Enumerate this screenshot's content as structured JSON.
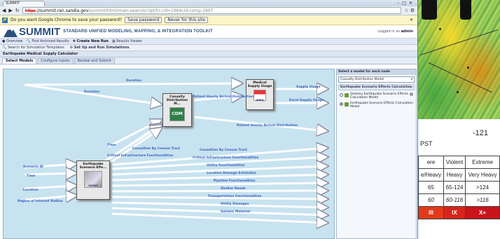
{
  "background": {
    "tick_label": "-121",
    "pst_label": "PST",
    "severity_table": {
      "rows": [
        [
          "ere",
          "Violent",
          "Extreme"
        ],
        [
          "e/Heavy",
          "Heavy",
          "Very Heavy"
        ],
        [
          "65",
          "65-124",
          ">124"
        ],
        [
          "60",
          "60-116",
          ">116"
        ],
        [
          "III",
          "IX",
          "X+"
        ]
      ],
      "last_row_colors": [
        "#e03a1a",
        "#d8241a",
        "#c8141a"
      ]
    }
  },
  "browser": {
    "tab_title": "SUMMIT",
    "url_scheme": "https",
    "url_host": "://summit.ran.sandia.gov",
    "url_path": "/summit/html/main.seam/script/hr.cid=1964cid-comp-1997",
    "password_prompt": "Do you want Google Chrome to save your password?",
    "save_password": "Save password",
    "never_for_site": "Never for this site"
  },
  "app": {
    "name": "SUMMIT",
    "tagline": "STANDARD UNIFIED MODELING, MAPPING, & INTEGRATION TOOLKIT",
    "logged_in_prefix": "Logged in as",
    "logged_in_user": "admin",
    "menu": [
      "Overview",
      "Find Archived Results",
      "Create New Run",
      "Results Viewer"
    ],
    "menu_selected": 2,
    "toolbar": [
      "Search for Simulation Templates",
      "Set Up and Run Simulations"
    ],
    "calculator_title": "Earthquake Medical Supply Calculator",
    "subtabs": [
      "Select Models",
      "Configure Inputs",
      "Review and Submit"
    ],
    "active_subtab": 0
  },
  "diagram": {
    "nodes": {
      "medical": "Medical Supply Usage",
      "casualty": "Casualty Distribution M...",
      "earthquake": "Earthquake Scenario Effe..."
    },
    "node_logos": {
      "medical": "AHRQ",
      "casualty": "CDM",
      "earthquake": "HAZUS"
    },
    "labels": {
      "duration_top": "Duration",
      "duration_mid": "Duration",
      "supply_usage": "Supply Usage",
      "excel_supply": "Excel Supply Usage",
      "patient_hourly": "Patient Hourly Arrival Distribution",
      "patient_hourly_out": "Patient Hourly Arrival Distribution",
      "time_mid": "Time",
      "casualties_tract": "Casualties By Census Tract",
      "critical_infra": "Critical Infrastructure Functionalities",
      "scenario_id": "Scenario ID",
      "time_left": "Time",
      "location": "Location",
      "region_radius": "Region of Interest Radius",
      "out_casualties": "Casualties By Census Tract",
      "out_critical": "Critical Infrastructure Functionalities",
      "out_utility": "Utility Functionalities",
      "out_location_damage": "Location Damage Estimates",
      "out_pipeline": "Pipeline Functionalities",
      "out_shelter": "Shelter Needs",
      "out_transport": "Transportation Functionalities",
      "out_utility_damages": "Utility Damages",
      "out_seismic": "Seismic Material"
    }
  },
  "right_panel": {
    "heading": "Select a model for each node",
    "dropdown_value": "Casualty Distribution Model",
    "section_title": "Earthquake Scenario Effects Calculation",
    "options": [
      {
        "label": "Sistemy Earthquake Scenario Effects Calculation Model",
        "selected": false
      },
      {
        "label": "Earthquake Scenario Effects Calculation Model",
        "selected": true
      }
    ]
  }
}
